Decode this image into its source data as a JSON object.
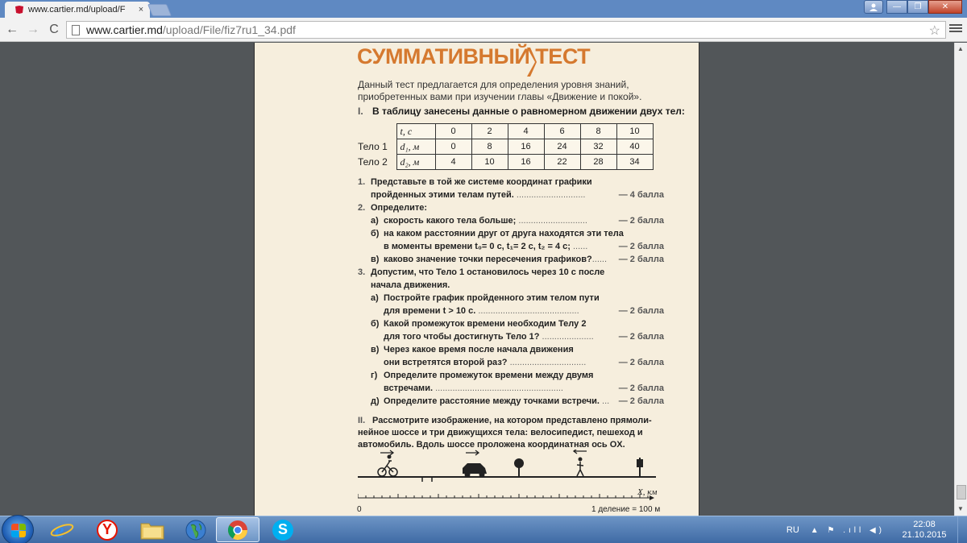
{
  "browser": {
    "tab_title": "www.cartier.md/upload/F",
    "tab_close": "×",
    "url_host": "www.cartier.md",
    "url_path": "/upload/File/fiz7ru1_34.pdf",
    "back": "←",
    "forward": "→",
    "reload": "C",
    "star": "☆",
    "win_min": "—",
    "win_restore": "❐",
    "win_close": "✕"
  },
  "doc": {
    "heading": "СУММАТИВНЫЙ ТЕСТ",
    "intro": "Данный тест предлагается для определения уровня знаний, приобретен­ных вами при изучении главы «Движение и покой».",
    "section1": {
      "roman": "I.",
      "text": "В таблицу занесены данные о равномерном движении двух тел:"
    },
    "table": {
      "header_label": "t, с",
      "header_values": [
        "0",
        "2",
        "4",
        "6",
        "8",
        "10"
      ],
      "rows": [
        {
          "name": "Тело 1",
          "label": "d₁, м",
          "values": [
            "0",
            "8",
            "16",
            "24",
            "32",
            "40"
          ]
        },
        {
          "name": "Тело 2",
          "label": "d₂, м",
          "values": [
            "4",
            "10",
            "16",
            "22",
            "28",
            "34"
          ]
        }
      ]
    },
    "questions": [
      {
        "kind": "num",
        "marker": "1.",
        "text": "Представьте в той же системе координат графики",
        "dots": "",
        "points": ""
      },
      {
        "kind": "cont",
        "marker": "",
        "text": "пройденных этими телам путей.",
        "dots": " ............................",
        "points": "— 4 балла"
      },
      {
        "kind": "num",
        "marker": "2.",
        "text": "Определите:",
        "dots": "",
        "points": ""
      },
      {
        "kind": "sub",
        "marker": "а)",
        "text": "скорость какого тела больше;",
        "dots": " ............................",
        "points": "— 2 балла"
      },
      {
        "kind": "sub",
        "marker": "б)",
        "text": "на каком расстоянии друг от друга находятся эти тела",
        "dots": "",
        "points": ""
      },
      {
        "kind": "cont2",
        "marker": "",
        "text": "в моменты времени  t₀= 0 с,  t₁= 2 с,  t₂ = 4 с;",
        "dots": "  ......",
        "points": "— 2 балла"
      },
      {
        "kind": "sub",
        "marker": "в)",
        "text": "каково значение точки пересечения графиков?",
        "dots": "......",
        "points": "— 2 балла"
      },
      {
        "kind": "num",
        "marker": "3.",
        "text": "Допустим, что Тело 1 остановилось через 10 с после",
        "dots": "",
        "points": ""
      },
      {
        "kind": "cont",
        "marker": "",
        "text": "начала движения.",
        "dots": "",
        "points": ""
      },
      {
        "kind": "sub",
        "marker": "а)",
        "text": "Постройте график пройденного этим телом пути",
        "dots": "",
        "points": ""
      },
      {
        "kind": "cont2",
        "marker": "",
        "text": "для времени t > 10 с.",
        "dots": " .........................................",
        "points": "— 2 балла"
      },
      {
        "kind": "sub",
        "marker": "б)",
        "text": "Какой промежуток времени необходим Телу 2",
        "dots": "",
        "points": ""
      },
      {
        "kind": "cont2",
        "marker": "",
        "text": "для того чтобы достигнуть Тело 1?",
        "dots": " .....................",
        "points": "— 2 балла"
      },
      {
        "kind": "sub",
        "marker": "в)",
        "text": "Через какое время после начала движения",
        "dots": "",
        "points": ""
      },
      {
        "kind": "cont2",
        "marker": "",
        "text": "они встретятся второй раз?",
        "dots": " ...............................",
        "points": "— 2 балла"
      },
      {
        "kind": "sub",
        "marker": "г)",
        "text": "Определите промежуток времени между двумя",
        "dots": "",
        "points": ""
      },
      {
        "kind": "cont2",
        "marker": "",
        "text": "встречами.",
        "dots": " ....................................................",
        "points": "— 2 балла"
      },
      {
        "kind": "sub",
        "marker": "д)",
        "text": "Определите расстояние между точками встречи.",
        "dots": " ...",
        "points": "— 2 балла"
      }
    ],
    "section2": {
      "roman": "II.",
      "text": "Рассмотрите изображение, на котором представлено прямоли­нейное шоссе и три движущихся тела: велосипедист, пешеход и автомобиль. Вдоль шоссе проложена координатная ось OX."
    },
    "axis_label": "X, км",
    "zero_label": "0",
    "scale_label": "1 деление = 100 м"
  },
  "taskbar": {
    "lang": "RU",
    "tray_icons": "▲ ⚑ .ıll ◀)",
    "time": "22:08",
    "date": "21.10.2015",
    "yandex_letter": "Y",
    "skype_letter": "S"
  },
  "colors": {
    "heading": "#d5792f",
    "page": "#f6eedd",
    "viewer_bg": "#525659",
    "tabstrip": "#5f89c2"
  }
}
